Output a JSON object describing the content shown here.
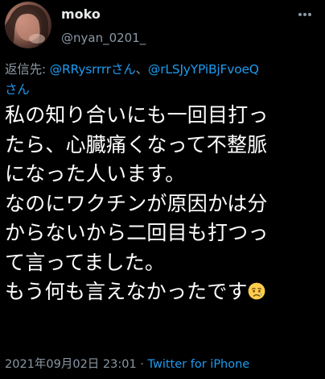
{
  "tweet": {
    "author": {
      "display_name": "moko",
      "handle": "@nyan_0201_"
    },
    "more_icon": "more-horizontal-icon",
    "reply_to": {
      "prefix": "返信先: ",
      "mention_1": "@RRysrrrrさん",
      "separator": "、",
      "mention_2_part1": "@rLSJyYPiBjFvoeQ",
      "mention_2_part2": "さん"
    },
    "lines": [
      "私の知り合いにも一回目打っ",
      "たら、心臓痛くなって不整脈",
      "になった人います。",
      "なのにワクチンが原因かは分",
      "からないから二回目も打つっ",
      "て言ってました。",
      "もう何も言えなかったです"
    ],
    "emoji": "sad-but-relieved-face-icon",
    "timestamp": "2021年09月02日 23:01",
    "meta_separator": " · ",
    "source": "Twitter for iPhone"
  },
  "colors": {
    "background": "#000000",
    "text": "#ffffff",
    "secondary": "#8b98a5",
    "link": "#1d9bf0"
  }
}
